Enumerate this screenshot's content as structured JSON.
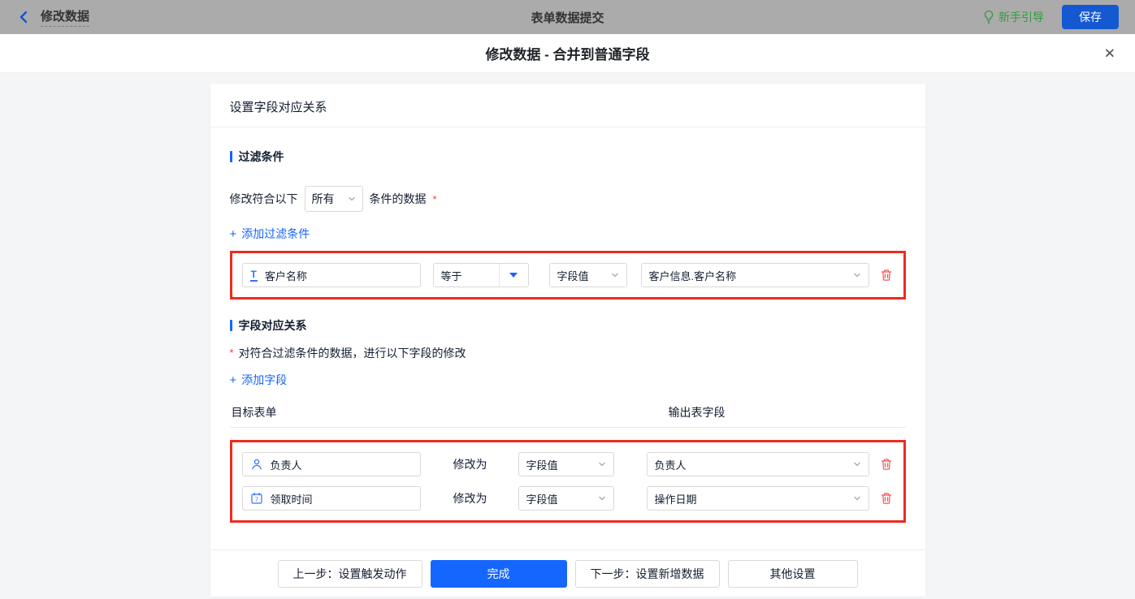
{
  "colors": {
    "primary_blue": "#1565ff",
    "annotation_red": "#ee2b1f",
    "trash_red": "#f0565c",
    "guide_green": "#2f9c3e",
    "topbar_gray": "#ababab"
  },
  "icons": {
    "plus": "+",
    "close": "✕",
    "required": "*",
    "text_field_glyph": "T",
    "calendar_day": "7"
  },
  "topbar": {
    "back_title": "修改数据",
    "center_title": "表单数据提交",
    "guide_label": "新手引导",
    "save_label": "保存"
  },
  "modal": {
    "title": "修改数据 - 合并到普通字段"
  },
  "panel": {
    "header": "设置字段对应关系",
    "filter": {
      "section_title": "过滤条件",
      "sentence_prefix": "修改符合以下",
      "match_mode": "所有",
      "sentence_suffix": "条件的数据",
      "add_link": "添加过滤条件",
      "condition": {
        "field": "客户名称",
        "operator": "等于",
        "value_type": "字段值",
        "value": "客户信息.客户名称"
      }
    },
    "mapping": {
      "section_title": "字段对应关系",
      "description": "对符合过滤条件的数据，进行以下字段的修改",
      "add_link": "添加字段",
      "columns": {
        "target": "目标表单",
        "output": "输出表字段"
      },
      "rows": [
        {
          "field": "负责人",
          "modify_label": "修改为",
          "value_type": "字段值",
          "value": "负责人"
        },
        {
          "field": "领取时间",
          "modify_label": "修改为",
          "value_type": "字段值",
          "value": "操作日期"
        }
      ]
    },
    "footer": {
      "prev": "上一步：设置触发动作",
      "done": "完成",
      "next": "下一步：设置新增数据",
      "other": "其他设置"
    }
  }
}
